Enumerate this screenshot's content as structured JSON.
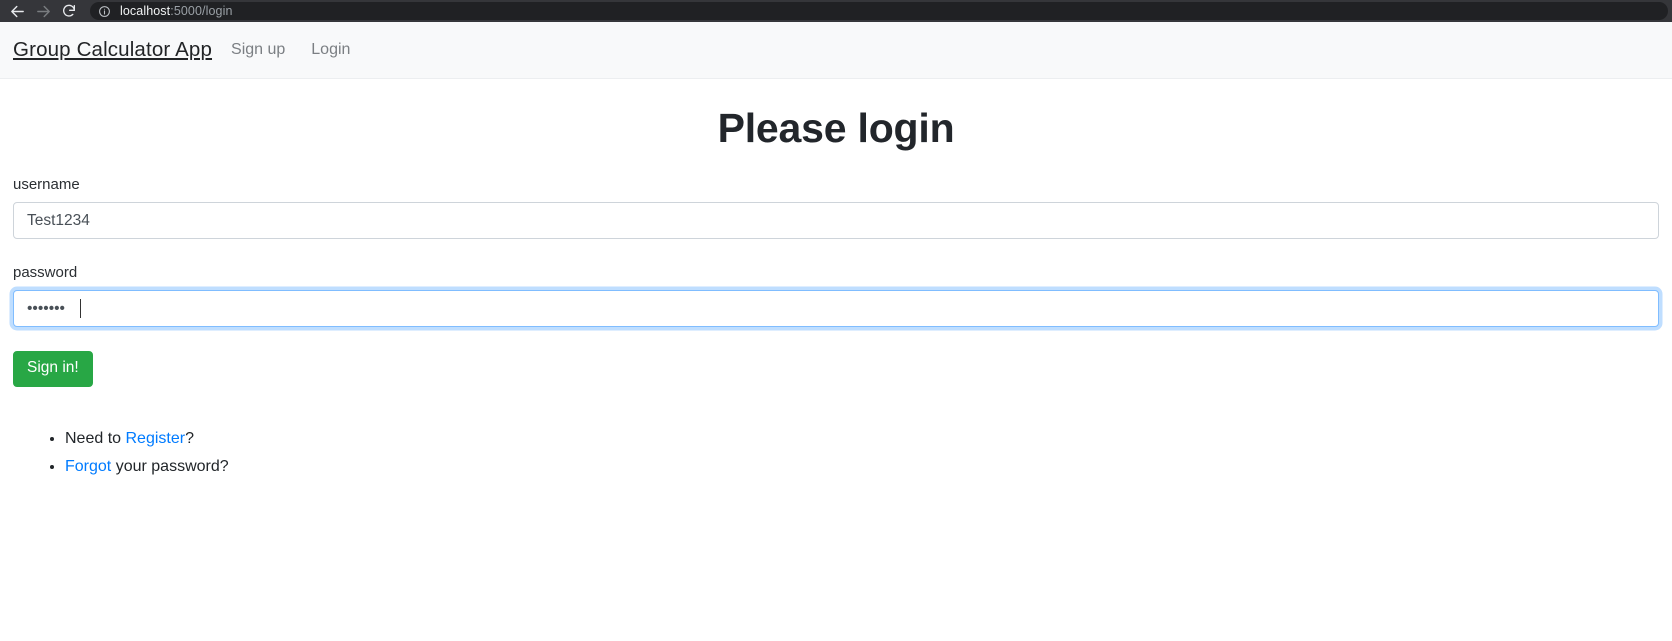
{
  "browser": {
    "back_icon": "arrow-left-icon",
    "forward_icon": "arrow-right-icon",
    "reload_icon": "reload-icon",
    "site_info_icon": "info-circle-icon",
    "url_host": "localhost",
    "url_path": ":5000/login",
    "chrome_bg": "#35363a",
    "url_pill_bg": "#202124"
  },
  "navbar": {
    "brand": "Group Calculator App",
    "links": [
      {
        "label": "Sign up",
        "name": "nav-link-sign-up"
      },
      {
        "label": "Login",
        "name": "nav-link-login"
      }
    ],
    "bg": "#f8f9fa"
  },
  "main": {
    "title": "Please login",
    "form": {
      "username": {
        "label": "username",
        "value": "Test1234",
        "placeholder": ""
      },
      "password": {
        "label": "password",
        "value": "•••••••",
        "placeholder": "",
        "focused": true,
        "masked_char_count": 7
      },
      "submit_label": "Sign in!",
      "submit_color": "#28a745"
    },
    "help_links": [
      {
        "prefix": "Need to ",
        "link": "Register",
        "suffix": "?"
      },
      {
        "prefix": "",
        "link": "Forgot",
        "suffix": " your password?"
      }
    ],
    "link_color": "#007bff"
  }
}
